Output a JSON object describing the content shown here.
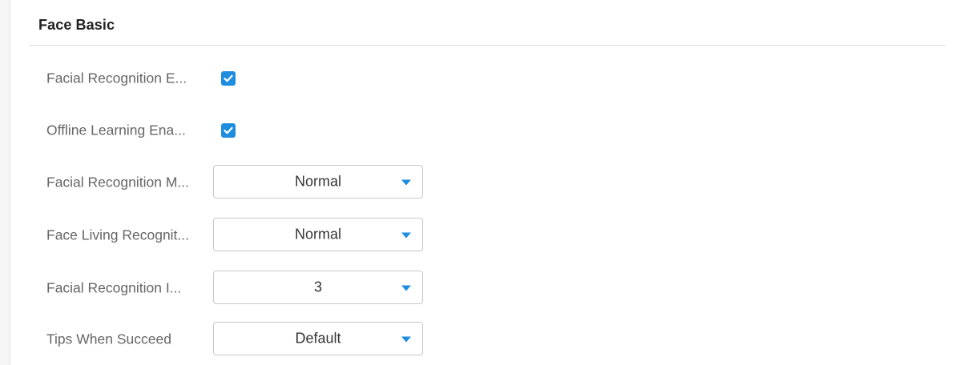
{
  "section": {
    "title": "Face Basic"
  },
  "colors": {
    "accent": "#1e8de0",
    "label": "#666666",
    "border": "#c8c8c8"
  },
  "fields": {
    "facial_recognition_enable": {
      "label": "Facial Recognition E...",
      "checked": true
    },
    "offline_learning_enable": {
      "label": "Offline Learning Ena...",
      "checked": true
    },
    "facial_recognition_mode": {
      "label": "Facial Recognition M...",
      "value": "Normal"
    },
    "face_living_recognition": {
      "label": "Face Living Recognit...",
      "value": "Normal"
    },
    "facial_recognition_interval": {
      "label": "Facial Recognition I...",
      "value": "3"
    },
    "tips_when_succeed": {
      "label": "Tips When Succeed",
      "value": "Default"
    }
  }
}
